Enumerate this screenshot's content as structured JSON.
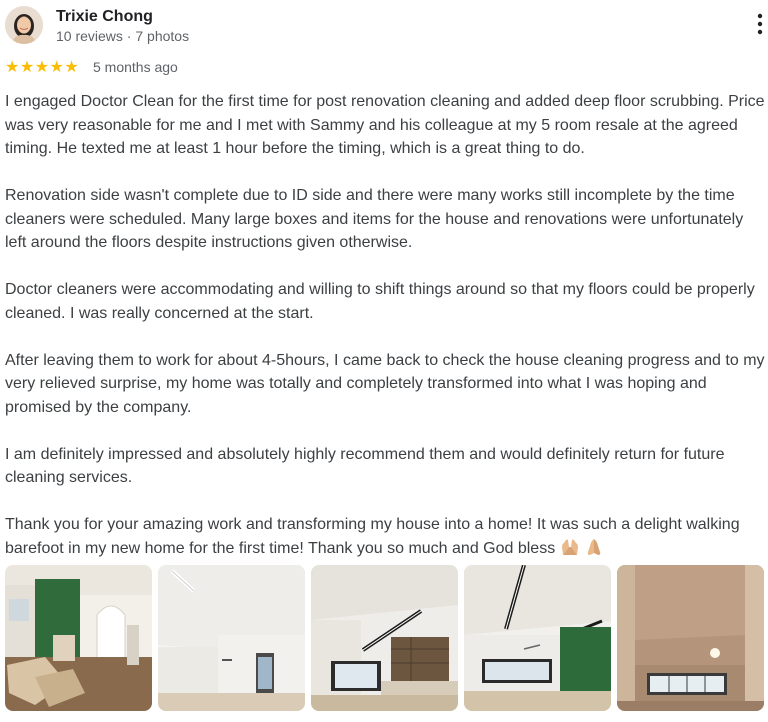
{
  "reviewer": {
    "name": "Trixie Chong",
    "meta": "10 reviews · 7 photos",
    "avatar_icon": "user-avatar-photo"
  },
  "rating": {
    "stars": 5,
    "stars_text": "★★★★★",
    "star_color": "#fbbc04",
    "date": "5 months ago"
  },
  "review": {
    "paragraphs": [
      "I engaged Doctor Clean for the first time for post renovation cleaning and added deep floor scrubbing. Price was very reasonable for me and I met with Sammy and his colleague at my 5 room resale at the agreed timing. He texted me at least 1 hour before the timing, which is a great thing to do.",
      "Renovation side wasn't complete due to ID side and there were many works still incomplete by the time cleaners were scheduled. Many large boxes and items for the house and renovations were unfortunately left around the floors despite instructions given otherwise.",
      "Doctor cleaners were accommodating and willing to shift things around so that my floors could be properly cleaned. I was really concerned at the start.",
      "After leaving them to work for about 4-5hours, I came back to check the house cleaning progress and to my very relieved surprise, my home was totally and completely transformed into what I was hoping and promised by the company.",
      "I am definitely impressed and absolutely highly recommend them and would definitely return for future cleaning services.",
      "Thank you for your amazing work and transforming my house into a home! It was such a delight walking barefoot in my new home for the first time! Thank you so much and God bless"
    ],
    "emojis": [
      "raising-hands-emoji",
      "folded-hands-emoji"
    ]
  },
  "photos": [
    {
      "icon": "room-photo-green-wall-boxes"
    },
    {
      "icon": "room-photo-empty-ceiling"
    },
    {
      "icon": "room-photo-kitchen-shelves"
    },
    {
      "icon": "room-photo-track-lights-green-wall"
    },
    {
      "icon": "room-photo-windows-ceiling-light"
    }
  ],
  "colors": {
    "name": "#202124",
    "meta": "#5f6368",
    "body": "#3c4043"
  }
}
